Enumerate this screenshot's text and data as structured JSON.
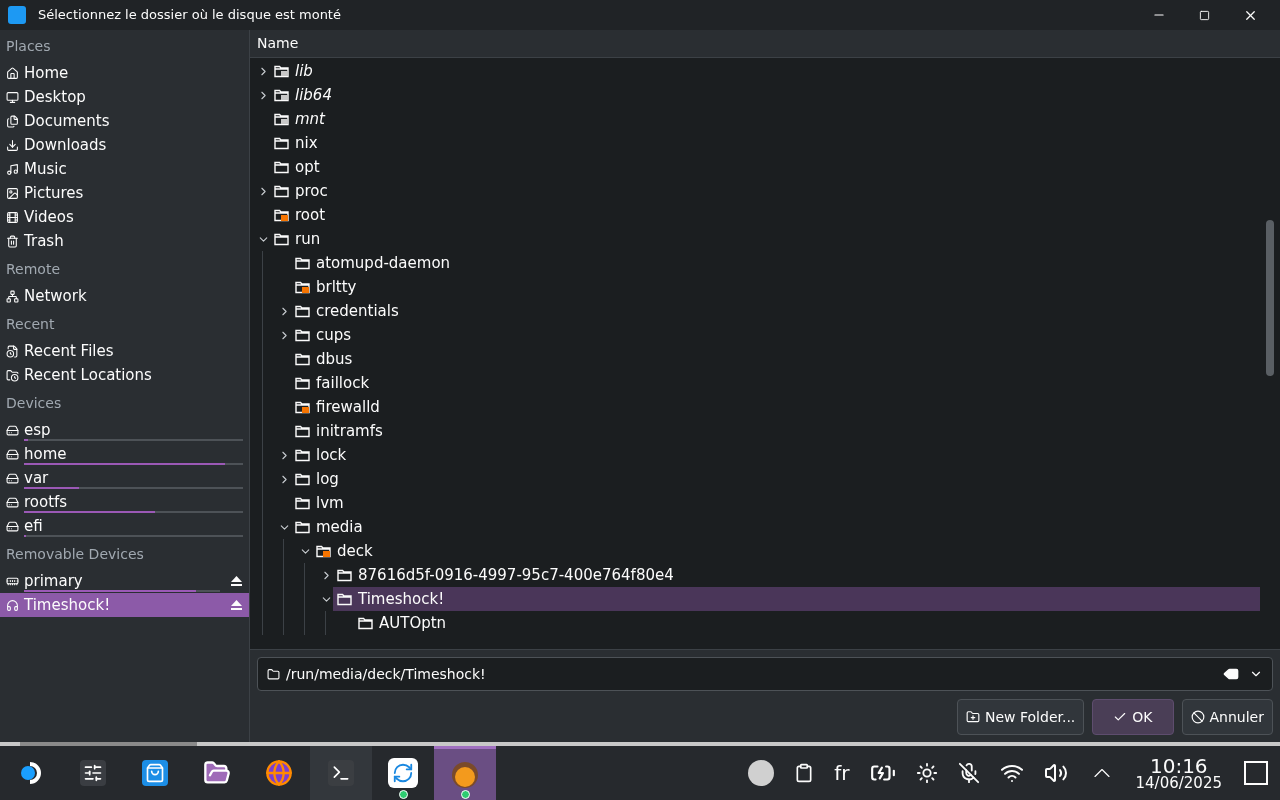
{
  "window": {
    "title": "Sélectionnez le dossier où le disque est monté"
  },
  "places": [
    {
      "heading": "Places",
      "items": [
        {
          "label": "Home",
          "selected": false
        },
        {
          "label": "Desktop",
          "selected": false
        },
        {
          "label": "Documents",
          "selected": false
        },
        {
          "label": "Downloads",
          "selected": false
        },
        {
          "label": "Music",
          "selected": false
        },
        {
          "label": "Pictures",
          "selected": false
        },
        {
          "label": "Videos",
          "selected": false
        },
        {
          "label": "Trash",
          "selected": false
        }
      ]
    },
    {
      "heading": "Remote",
      "items": [
        {
          "label": "Network",
          "selected": false
        }
      ]
    },
    {
      "heading": "Recent",
      "items": [
        {
          "label": "Recent Files",
          "selected": false
        },
        {
          "label": "Recent Locations",
          "selected": false
        }
      ]
    },
    {
      "heading": "Devices",
      "items": [
        {
          "label": "esp",
          "selected": false,
          "level": 0.02
        },
        {
          "label": "home",
          "selected": false,
          "level": 0.92
        },
        {
          "label": "var",
          "selected": false,
          "level": 0.25
        },
        {
          "label": "rootfs",
          "selected": false,
          "level": 0.6
        },
        {
          "label": "efi",
          "selected": false,
          "level": 0.01
        }
      ]
    },
    {
      "heading": "Removable Devices",
      "items": [
        {
          "label": "primary",
          "selected": false,
          "level": 0.88,
          "eject": true
        },
        {
          "label": "Timeshock!",
          "selected": true,
          "eject": true
        }
      ]
    }
  ],
  "tree": {
    "column": "Name",
    "items": [
      {
        "name": "lib",
        "kind": "symlink",
        "expanded": false,
        "selected": false
      },
      {
        "name": "lib64",
        "kind": "symlink",
        "expanded": false,
        "selected": false
      },
      {
        "name": "mnt",
        "kind": "symlink",
        "selected": false
      },
      {
        "name": "nix",
        "kind": "folder",
        "selected": false
      },
      {
        "name": "opt",
        "kind": "folder",
        "selected": false
      },
      {
        "name": "proc",
        "kind": "folder",
        "expanded": false,
        "selected": false
      },
      {
        "name": "root",
        "kind": "locked",
        "selected": false
      },
      {
        "name": "run",
        "kind": "folder",
        "expanded": true,
        "selected": false,
        "children": [
          {
            "name": "atomupd-daemon",
            "kind": "folder",
            "selected": false
          },
          {
            "name": "brltty",
            "kind": "locked",
            "selected": false
          },
          {
            "name": "credentials",
            "kind": "folder",
            "expanded": false,
            "selected": false
          },
          {
            "name": "cups",
            "kind": "folder",
            "expanded": false,
            "selected": false
          },
          {
            "name": "dbus",
            "kind": "folder",
            "selected": false
          },
          {
            "name": "faillock",
            "kind": "folder",
            "selected": false
          },
          {
            "name": "firewalld",
            "kind": "locked",
            "selected": false
          },
          {
            "name": "initramfs",
            "kind": "folder",
            "selected": false
          },
          {
            "name": "lock",
            "kind": "folder",
            "expanded": false,
            "selected": false
          },
          {
            "name": "log",
            "kind": "folder",
            "expanded": false,
            "selected": false
          },
          {
            "name": "lvm",
            "kind": "folder",
            "selected": false
          },
          {
            "name": "media",
            "kind": "folder",
            "expanded": true,
            "selected": false,
            "children": [
              {
                "name": "deck",
                "kind": "locked",
                "expanded": true,
                "selected": false,
                "children": [
                  {
                    "name": "87616d5f-0916-4997-95c7-400e764f80e4",
                    "kind": "folder",
                    "expanded": false,
                    "selected": false
                  },
                  {
                    "name": "Timeshock!",
                    "kind": "folder",
                    "expanded": true,
                    "selected": true,
                    "children": [
                      {
                        "name": "AUTOptn",
                        "kind": "folder",
                        "selected": false
                      }
                    ]
                  }
                ]
              }
            ]
          }
        ]
      }
    ]
  },
  "location": {
    "value": "/run/media/deck/Timeshock!"
  },
  "buttons": [
    {
      "label": "New Folder...",
      "default": false
    },
    {
      "label": "OK",
      "default": true
    },
    {
      "label": "Annuler",
      "default": false
    }
  ],
  "taskbar": {
    "apps": [
      {
        "selected": false,
        "hovered": false,
        "badge": false
      },
      {
        "selected": false,
        "hovered": false,
        "badge": false
      },
      {
        "selected": false,
        "hovered": false,
        "badge": false
      },
      {
        "selected": false,
        "hovered": false,
        "badge": false
      },
      {
        "selected": false,
        "hovered": false,
        "badge": false
      },
      {
        "selected": false,
        "hovered": true,
        "badge": false
      },
      {
        "selected": false,
        "hovered": false,
        "badge": true
      },
      {
        "selected": true,
        "hovered": false,
        "badge": true
      }
    ],
    "keyboard": "fr",
    "time": "10:16",
    "date": "14/06/2025"
  }
}
